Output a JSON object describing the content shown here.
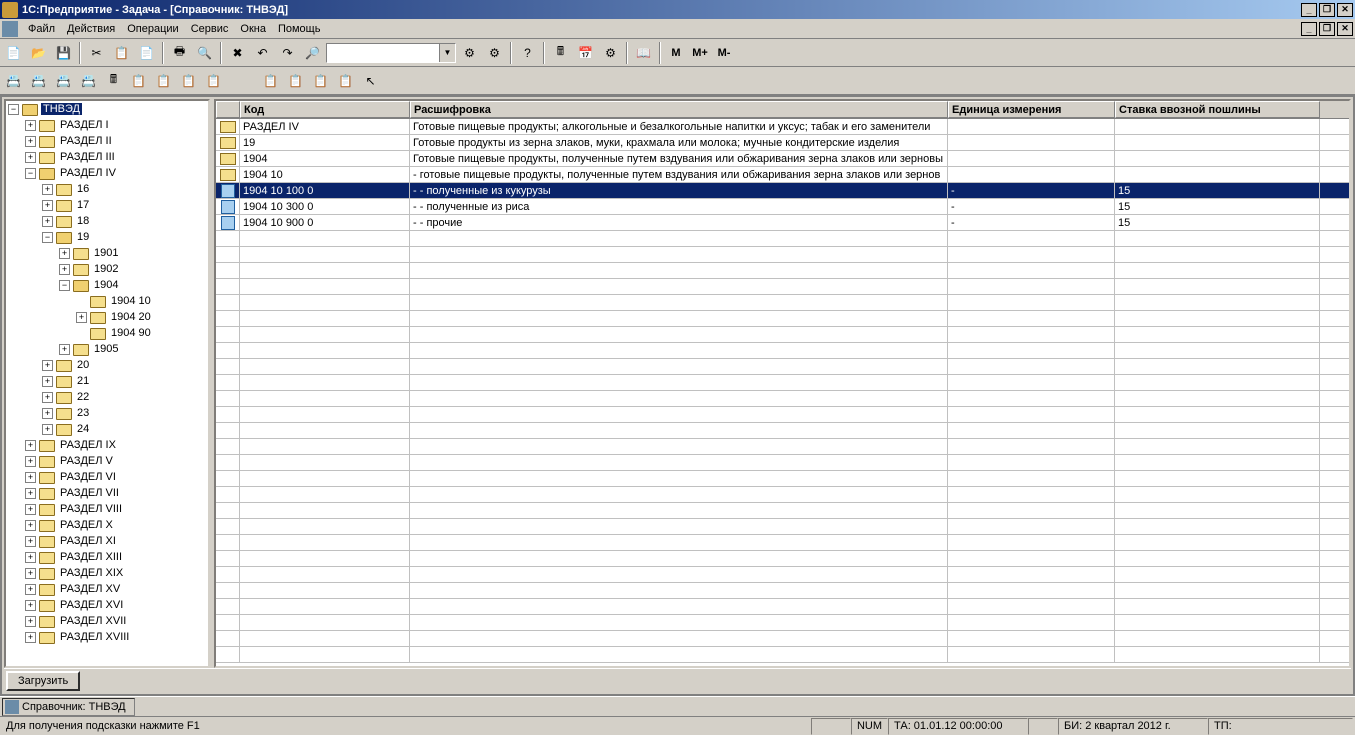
{
  "title": "1С:Предприятие - Задача - [Справочник: ТНВЭД]",
  "menu": [
    "Файл",
    "Действия",
    "Операции",
    "Сервис",
    "Окна",
    "Помощь"
  ],
  "memory_buttons": [
    "M",
    "M+",
    "M-"
  ],
  "tree": {
    "root": "ТНВЭД",
    "items": [
      {
        "level": 1,
        "exp": "+",
        "label": "РАЗДЕЛ I"
      },
      {
        "level": 1,
        "exp": "+",
        "label": "РАЗДЕЛ II"
      },
      {
        "level": 1,
        "exp": "+",
        "label": "РАЗДЕЛ III"
      },
      {
        "level": 1,
        "exp": "-",
        "label": "РАЗДЕЛ IV",
        "open": true
      },
      {
        "level": 2,
        "exp": "+",
        "label": "16"
      },
      {
        "level": 2,
        "exp": "+",
        "label": "17"
      },
      {
        "level": 2,
        "exp": "+",
        "label": "18"
      },
      {
        "level": 2,
        "exp": "-",
        "label": "19",
        "open": true
      },
      {
        "level": 3,
        "exp": "+",
        "label": "1901"
      },
      {
        "level": 3,
        "exp": "+",
        "label": "1902"
      },
      {
        "level": 3,
        "exp": "-",
        "label": "1904",
        "open": true
      },
      {
        "level": 4,
        "exp": "",
        "label": "1904 10"
      },
      {
        "level": 4,
        "exp": "+",
        "label": "1904 20"
      },
      {
        "level": 4,
        "exp": "",
        "label": "1904 90"
      },
      {
        "level": 3,
        "exp": "+",
        "label": "1905"
      },
      {
        "level": 2,
        "exp": "+",
        "label": "20"
      },
      {
        "level": 2,
        "exp": "+",
        "label": "21"
      },
      {
        "level": 2,
        "exp": "+",
        "label": "22"
      },
      {
        "level": 2,
        "exp": "+",
        "label": "23"
      },
      {
        "level": 2,
        "exp": "+",
        "label": "24"
      },
      {
        "level": 1,
        "exp": "+",
        "label": "РАЗДЕЛ IX"
      },
      {
        "level": 1,
        "exp": "+",
        "label": "РАЗДЕЛ V"
      },
      {
        "level": 1,
        "exp": "+",
        "label": "РАЗДЕЛ VI"
      },
      {
        "level": 1,
        "exp": "+",
        "label": "РАЗДЕЛ VII"
      },
      {
        "level": 1,
        "exp": "+",
        "label": "РАЗДЕЛ VIII"
      },
      {
        "level": 1,
        "exp": "+",
        "label": "РАЗДЕЛ X"
      },
      {
        "level": 1,
        "exp": "+",
        "label": "РАЗДЕЛ XI"
      },
      {
        "level": 1,
        "exp": "+",
        "label": "РАЗДЕЛ XIII"
      },
      {
        "level": 1,
        "exp": "+",
        "label": "РАЗДЕЛ XIX"
      },
      {
        "level": 1,
        "exp": "+",
        "label": "РАЗДЕЛ XV"
      },
      {
        "level": 1,
        "exp": "+",
        "label": "РАЗДЕЛ XVI"
      },
      {
        "level": 1,
        "exp": "+",
        "label": "РАЗДЕЛ XVII"
      },
      {
        "level": 1,
        "exp": "+",
        "label": "РАЗДЕЛ XVIII"
      }
    ]
  },
  "table": {
    "columns": [
      "Код",
      "Расшифровка",
      "Единица измерения",
      "Ставка ввозной пошлины"
    ],
    "rows": [
      {
        "type": "folder",
        "code": "РАЗДЕЛ IV",
        "desc": "Готовые пищевые продукты; алкогольные и безалкогольные напитки и уксус; табак и его заменители",
        "unit": "",
        "rate": ""
      },
      {
        "type": "folder",
        "code": "19",
        "desc": "Готовые продукты из зерна злаков, муки, крахмала или молока; мучные кондитерские изделия",
        "unit": "",
        "rate": ""
      },
      {
        "type": "folder",
        "code": "1904",
        "desc": "Готовые пищевые продукты, полученные путем вздувания или обжаривания зерна злаков или зерновы",
        "unit": "",
        "rate": ""
      },
      {
        "type": "folder",
        "code": "1904 10",
        "desc": "- готовые пищевые продукты, полученные путем вздувания или обжаривания зерна злаков или зернов",
        "unit": "",
        "rate": ""
      },
      {
        "type": "item",
        "code": "1904 10 100 0",
        "desc": "- - полученные из кукурузы",
        "unit": "-",
        "rate": "15",
        "selected": true
      },
      {
        "type": "item",
        "code": "1904 10 300 0",
        "desc": "- - полученные из риса",
        "unit": "-",
        "rate": "15"
      },
      {
        "type": "item",
        "code": "1904 10 900 0",
        "desc": "- - прочие",
        "unit": "-",
        "rate": "15"
      }
    ],
    "empty_rows": 27
  },
  "load_button": "Загрузить",
  "task_item": "Справочник: ТНВЭД",
  "status": {
    "hint": "Для получения подсказки нажмите F1",
    "num": "NUM",
    "ta": "ТА: 01.01.12  00:00:00",
    "bi": "БИ: 2 квартал 2012 г.",
    "tp": "ТП:"
  }
}
